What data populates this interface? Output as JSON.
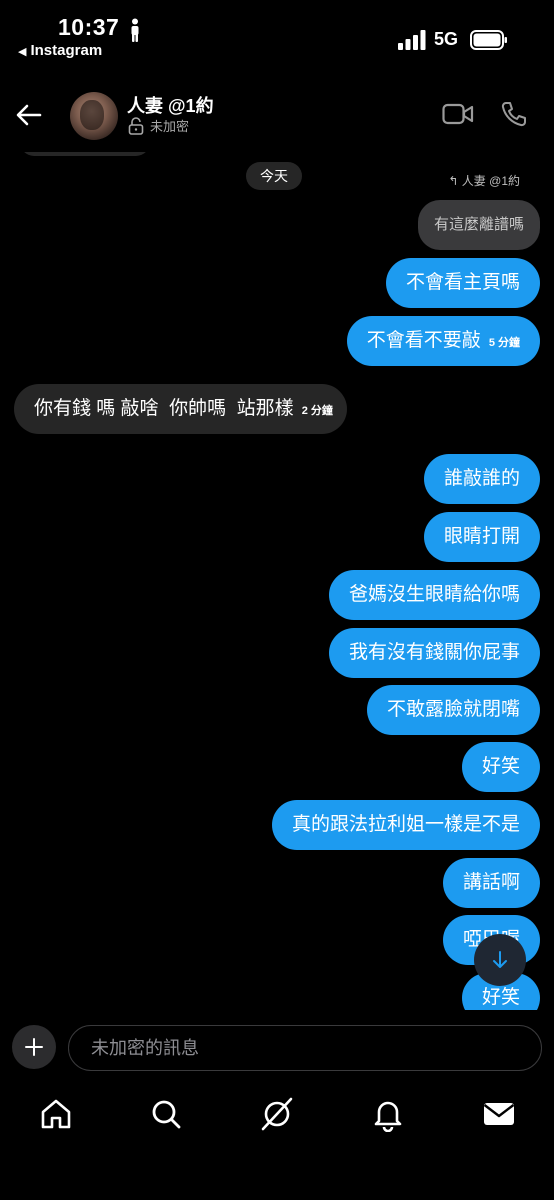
{
  "status_bar": {
    "time": "10:37",
    "back_app": "Instagram",
    "network": "5G"
  },
  "header": {
    "name": "人妻 @1約",
    "encryption": "未加密",
    "icons": [
      "back-arrow-icon",
      "video-call-icon",
      "phone-call-icon"
    ]
  },
  "chat": {
    "date_label": "今天",
    "reply_tag": "人妻 @1約",
    "quoted_message": "有這麼離譜嗎",
    "messages": [
      {
        "side": "out",
        "text": "不會看主頁嗎",
        "time": ""
      },
      {
        "side": "out",
        "text": "不會看不要敲",
        "time": "5 分鐘"
      },
      {
        "side": "in",
        "text": "你有錢 嗎 敲啥  你帥嗎  站那樣",
        "time": "2 分鐘"
      },
      {
        "side": "out",
        "text": "誰敲誰的",
        "time": ""
      },
      {
        "side": "out",
        "text": "眼睛打開",
        "time": ""
      },
      {
        "side": "out",
        "text": "爸媽沒生眼睛給你嗎",
        "time": ""
      },
      {
        "side": "out",
        "text": "我有沒有錢關你屁事",
        "time": ""
      },
      {
        "side": "out",
        "text": "不敢露臉就閉嘴",
        "time": ""
      },
      {
        "side": "out",
        "text": "好笑",
        "time": ""
      },
      {
        "side": "out",
        "text": "真的跟法拉利姐一樣是不是",
        "time": ""
      },
      {
        "side": "out",
        "text": "講話啊",
        "time": ""
      },
      {
        "side": "out",
        "text": "啞巴喔",
        "time": ""
      },
      {
        "side": "out",
        "text": "好笑",
        "time": ""
      }
    ]
  },
  "composer": {
    "placeholder": "未加密的訊息"
  },
  "bottom_nav": {
    "items": [
      "home-icon",
      "search-icon",
      "explore-icon",
      "notifications-icon",
      "messages-icon"
    ]
  },
  "colors": {
    "outgoing_bubble": "#1d9bf0",
    "incoming_bubble": "#262626",
    "background": "#000000"
  }
}
